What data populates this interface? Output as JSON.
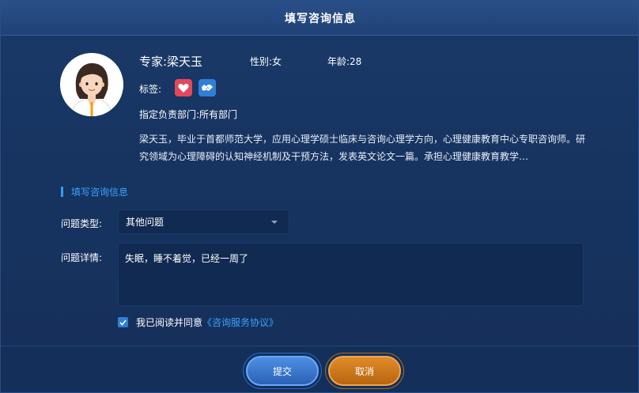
{
  "dialog": {
    "title": "填写咨询信息"
  },
  "expert": {
    "name": "专家:梁天玉",
    "gender": "性别:女",
    "age": "年龄:28",
    "tags_label": "标签:",
    "tags": [
      {
        "icon": "heart-icon",
        "color": "#e2495a"
      },
      {
        "icon": "handshake-icon",
        "color": "#2f7fd6"
      }
    ],
    "department": "指定负责部门:所有部门",
    "bio": "梁天玉，毕业于首都师范大学，应用心理学硕士临床与咨询心理学方向，心理健康教育中心专职咨询师。研究领域为心理障碍的认知神经机制及干预方法，发表英文论文一篇。承担心理健康教育教学…"
  },
  "form": {
    "section_title": "填写咨询信息",
    "type_label": "问题类型:",
    "type_value": "其他问题",
    "detail_label": "问题详情:",
    "detail_value": "失眠，睡不着觉，已经一周了",
    "agree_checked": true,
    "agree_text": "我已阅读并同意",
    "agree_link": "《咨询服务协议》"
  },
  "buttons": {
    "submit": "提交",
    "cancel": "取消"
  },
  "colors": {
    "accent": "#3aa2ff",
    "submit": "#2a62b6",
    "cancel": "#d07a1e",
    "background": "#173461"
  }
}
